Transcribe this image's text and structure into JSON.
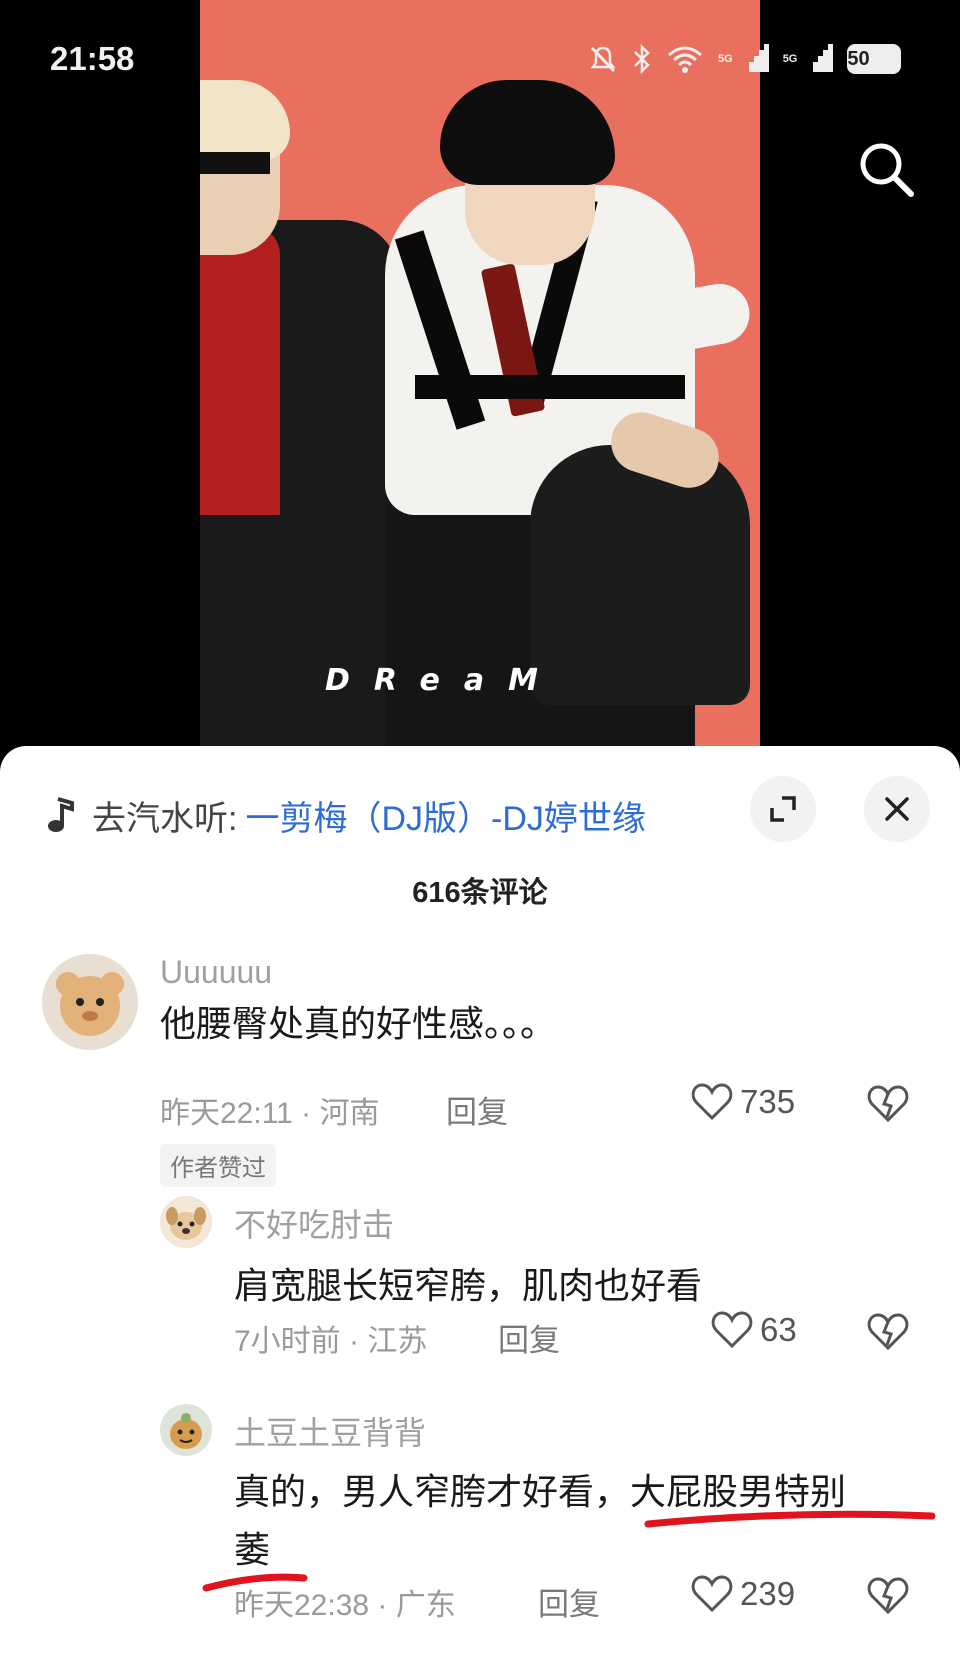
{
  "status_bar": {
    "time": "21:58",
    "network_1": "5G",
    "network_2": "5G",
    "battery": "50"
  },
  "video": {
    "overlay_text": "DReaM"
  },
  "music": {
    "prefix": "去汽水听:",
    "title": "一剪梅（DJ版）-DJ婷世缘"
  },
  "comments_header": {
    "count_label": "616条评论"
  },
  "comments": [
    {
      "username": "Uuuuuu",
      "text": "他腰臀处真的好性感。。。",
      "meta": "昨天22:11 · 河南",
      "reply_label": "回复",
      "likes": "735",
      "badge": "作者赞过"
    },
    {
      "username": "不好吃肘击",
      "text": "肩宽腿长短窄胯，肌肉也好看",
      "meta": "7小时前 · 江苏",
      "reply_label": "回复",
      "likes": "63"
    },
    {
      "username": "土豆土豆背背",
      "text_line1": "真的，男人窄胯才好看，大屁股男特别",
      "text_line2": "萎",
      "meta": "昨天22:38 · 广东",
      "reply_label": "回复",
      "likes": "239"
    }
  ],
  "colors": {
    "video_background": "#e9705f",
    "link_blue": "#2d6cd6",
    "annotation_red": "#e0141e"
  },
  "icons": [
    "music-note-icon",
    "search-icon",
    "expand-icon",
    "close-icon",
    "heart-icon",
    "broken-heart-icon",
    "mute-bell-icon",
    "bluetooth-icon",
    "wifi-icon",
    "signal-icon",
    "battery-icon"
  ]
}
